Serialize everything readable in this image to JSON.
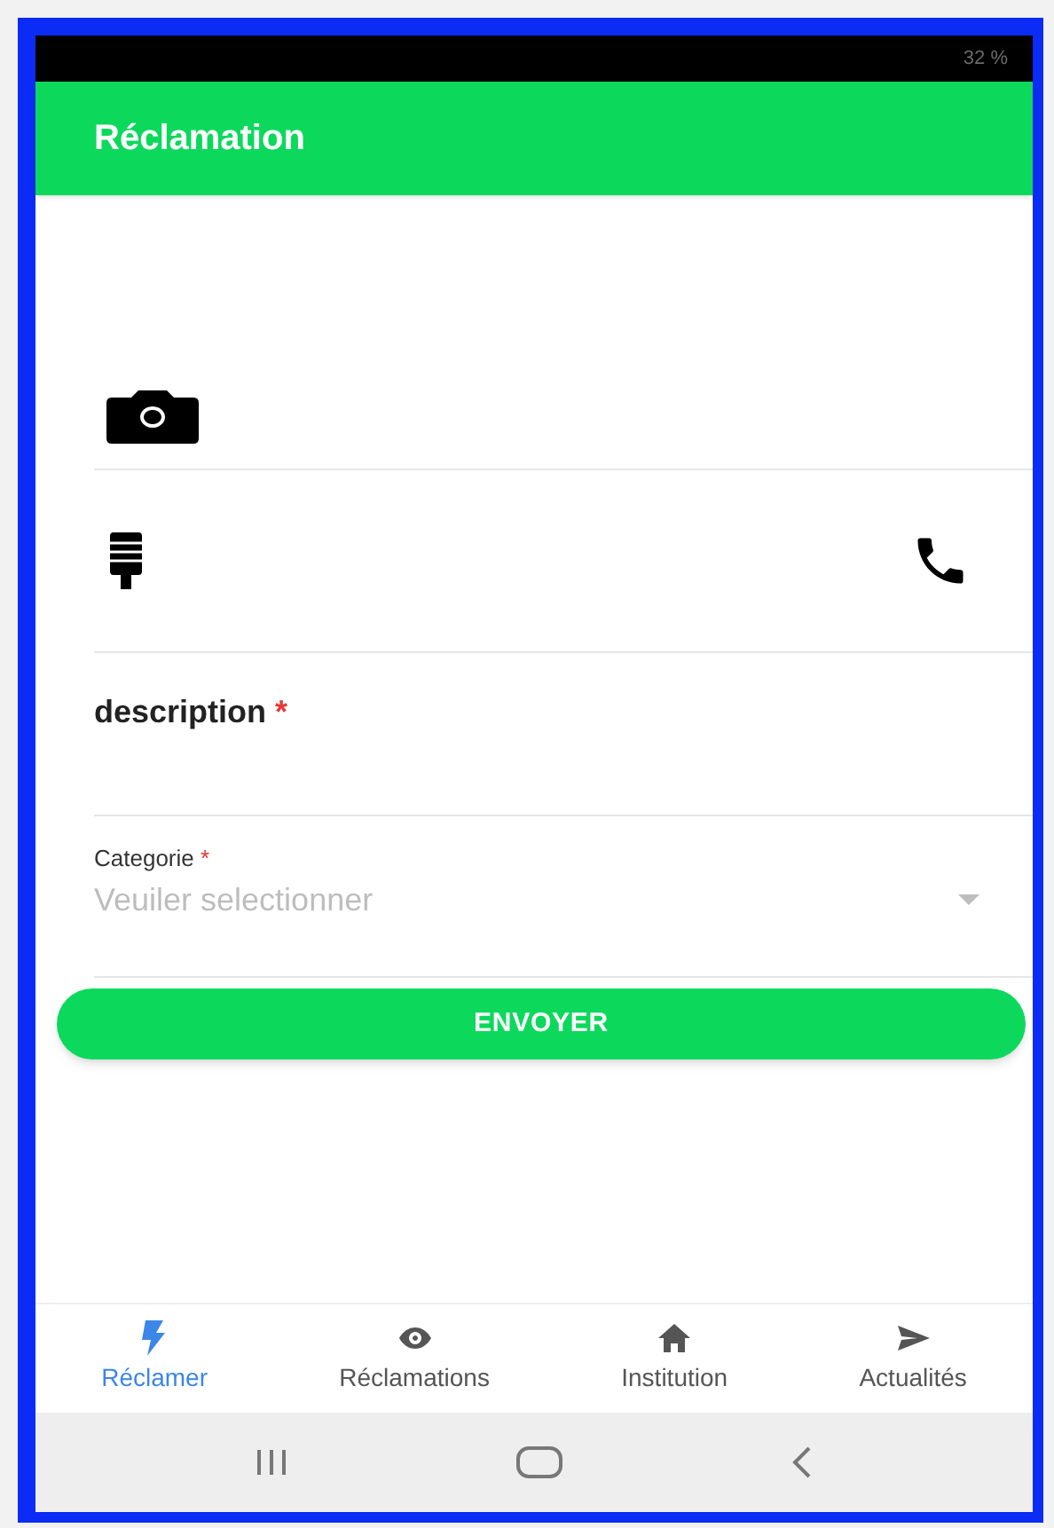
{
  "status_bar": {
    "battery": "32 %"
  },
  "app_bar": {
    "title": "Réclamation"
  },
  "form": {
    "description": {
      "label": "description",
      "required_mark": "*"
    },
    "category": {
      "label": "Categorie",
      "required_mark": "*",
      "placeholder": "Veuiler selectionner"
    },
    "submit": "ENVOYER"
  },
  "bottom_nav": [
    {
      "label": "Réclamer",
      "selected": true
    },
    {
      "label": "Réclamations",
      "selected": false
    },
    {
      "label": "Institution",
      "selected": false
    },
    {
      "label": "Actualités",
      "selected": false
    }
  ]
}
